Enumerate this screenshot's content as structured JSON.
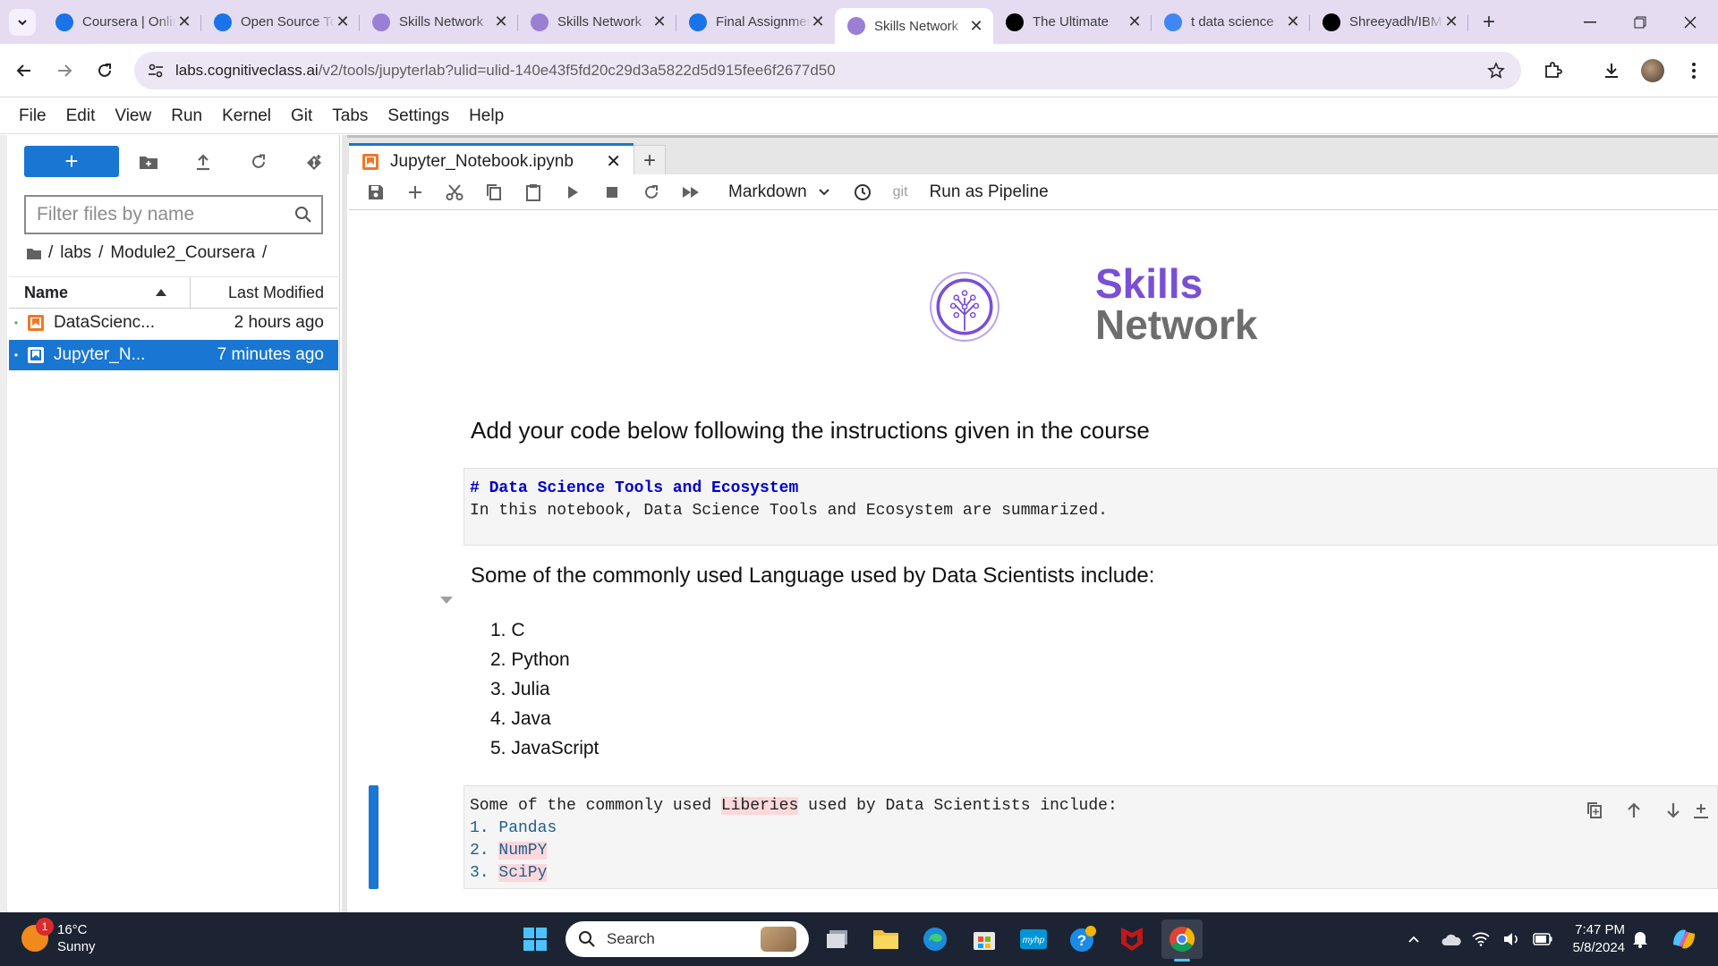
{
  "browser": {
    "tabs": [
      {
        "title": "Coursera | Online",
        "icon": "coursera-icon",
        "color": "#1a73e8"
      },
      {
        "title": "Open Source Tools",
        "icon": "coursera-icon",
        "color": "#1a73e8"
      },
      {
        "title": "Skills Network",
        "icon": "skills-network-icon",
        "color": "#9b7fd4"
      },
      {
        "title": "Skills Network",
        "icon": "skills-network-icon",
        "color": "#9b7fd4"
      },
      {
        "title": "Final Assignment",
        "icon": "coursera-icon",
        "color": "#1a73e8"
      },
      {
        "title": "Skills Network",
        "icon": "skills-network-icon",
        "color": "#9b7fd4",
        "active": true
      },
      {
        "title": "The Ultimate",
        "icon": "medium-icon",
        "color": "#000000"
      },
      {
        "title": "t data science",
        "icon": "google-icon",
        "color": "#4285f4"
      },
      {
        "title": "Shreeyadh/IBM",
        "icon": "github-icon",
        "color": "#000000"
      }
    ],
    "url_host": "labs.cognitiveclass.ai",
    "url_path": "/v2/tools/jupyterlab?ulid=ulid-140e43f5fd20c29d3a5822d5d915fee6f2677d50"
  },
  "jupyter": {
    "menu": [
      "File",
      "Edit",
      "View",
      "Run",
      "Kernel",
      "Git",
      "Tabs",
      "Settings",
      "Help"
    ],
    "filter_placeholder": "Filter files by name",
    "breadcrumb": [
      "labs",
      "Module2_Coursera"
    ],
    "columns": {
      "name": "Name",
      "modified": "Last Modified"
    },
    "files": [
      {
        "name": "DataScienc...",
        "modified": "2 hours ago",
        "selected": false
      },
      {
        "name": "Jupyter_N...",
        "modified": "7 minutes ago",
        "selected": true
      }
    ],
    "notebook_tab": "Jupyter_Notebook.ipynb",
    "cell_type": "Markdown",
    "git_label": "git",
    "pipeline_label": "Run as Pipeline"
  },
  "notebook": {
    "logo_line1": "Skills",
    "logo_line2": "Network",
    "heading": "Add your code below following the instructions given in the course",
    "cell1_line1": "# Data Science Tools and Ecosystem",
    "cell1_line2": "In this notebook, Data Science Tools and Ecosystem are summarized.",
    "languages_intro": "Some of the commonly used Language used by Data Scientists include:",
    "languages": [
      "1. C",
      "2. Python",
      "3. Julia",
      "4. Java",
      "5. JavaScript"
    ],
    "lib_intro_a": " Some of the commonly used ",
    "lib_intro_word": "Liberies",
    "lib_intro_b": " used by Data Scientists include:",
    "libs": [
      {
        "num": "1. ",
        "name": "Pandas",
        "misspelled": false
      },
      {
        "num": "2. ",
        "name": "NumPY",
        "misspelled": true
      },
      {
        "num": "3. ",
        "name": "SciPy",
        "misspelled": true
      }
    ]
  },
  "taskbar": {
    "weather_temp": "16°C",
    "weather_desc": "Sunny",
    "weather_badge": "1",
    "search_label": "Search",
    "time": "7:47 PM",
    "date": "5/8/2024"
  },
  "colors": {
    "jupyter_blue": "#1976d2",
    "skills_purple": "#7a4fd6",
    "tabstrip": "#e5dcf2",
    "taskbar": "#1c2433"
  }
}
